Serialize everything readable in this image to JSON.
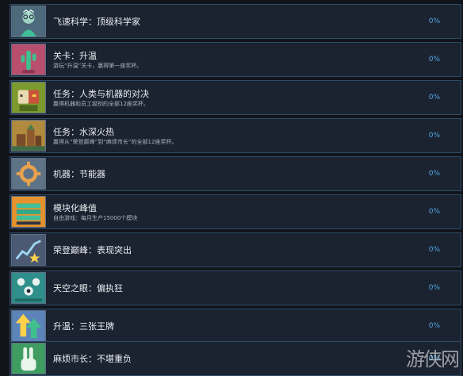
{
  "achievements": [
    {
      "title": "飞速科学：顶级科学家",
      "desc": "",
      "progress": "0%",
      "icon": "scientist-icon",
      "icon_bg": "#4d6a7d"
    },
    {
      "title": "关卡：升温",
      "desc": "游玩“升温”关卡，赢得第一座奖杯。",
      "progress": "0%",
      "icon": "cactus-icon",
      "icon_bg": "#b84f6f"
    },
    {
      "title": "任务：人类与机器的对决",
      "desc": "赢得机器和员工级别的全部12座奖杯。",
      "progress": "0%",
      "icon": "robot-human-icon",
      "icon_bg": "#7a9a2e"
    },
    {
      "title": "任务：水深火热",
      "desc": "赢得从“荣登巅峰”到“麻烦市长”的全部12座奖杯。",
      "progress": "0%",
      "icon": "town-icon",
      "icon_bg": "#b08a3e"
    },
    {
      "title": "机器：节能器",
      "desc": "",
      "progress": "0%",
      "icon": "gear-icon",
      "icon_bg": "#5f7386"
    },
    {
      "title": "模块化峰值",
      "desc": "自由游戏：每月生产15000个模块",
      "progress": "0%",
      "icon": "modules-icon",
      "icon_bg": "#e6932d"
    },
    {
      "title": "荣登巅峰：表现突出",
      "desc": "",
      "progress": "0%",
      "icon": "chart-star-icon",
      "icon_bg": "#4b5a72"
    },
    {
      "title": "天空之眼：偏执狂",
      "desc": "",
      "progress": "0%",
      "icon": "drones-icon",
      "icon_bg": "#2f8f8a"
    },
    {
      "title": "升温：三张王牌",
      "desc": "",
      "progress": "0%",
      "icon": "up-arrows-icon",
      "icon_bg": "#5c84b8"
    },
    {
      "title": "麻烦市长：不堪重负",
      "desc": "",
      "progress": "0%",
      "icon": "peace-hand-icon",
      "icon_bg": "#3f9d62"
    }
  ],
  "watermark": "游侠网"
}
